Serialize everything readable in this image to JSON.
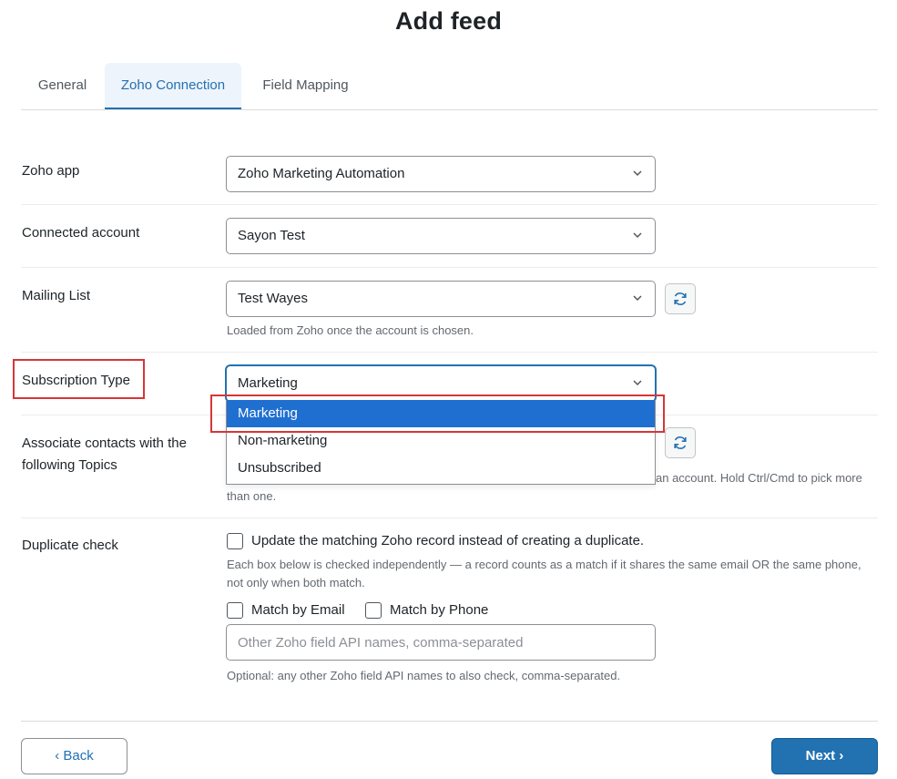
{
  "page": {
    "title": "Add feed"
  },
  "tabs": [
    {
      "label": "General",
      "active": false
    },
    {
      "label": "Zoho Connection",
      "active": true
    },
    {
      "label": "Field Mapping",
      "active": false
    }
  ],
  "form": {
    "zoho_app": {
      "label": "Zoho app",
      "value": "Zoho Marketing Automation"
    },
    "connected_account": {
      "label": "Connected account",
      "value": "Sayon Test"
    },
    "mailing_list": {
      "label": "Mailing List",
      "value": "Test Wayes",
      "help": "Loaded from Zoho once the account is chosen."
    },
    "subscription_type": {
      "label": "Subscription Type",
      "value": "Marketing",
      "options": [
        "Marketing",
        "Non-marketing",
        "Unsubscribed"
      ],
      "selected_option": "Marketing"
    },
    "topics": {
      "label_line1": "Associate contacts with the",
      "label_line2": "following Topics",
      "help_line1": "an account. Hold Ctrl/Cmd to pick more",
      "help_line2": "than one."
    },
    "duplicate_check": {
      "label": "Duplicate check",
      "update_label": "Update the matching Zoho record instead of creating a duplicate.",
      "help_line1": "Each box below is checked independently — a record counts as a match if it shares the same email OR the same phone,",
      "help_line2": "not only when both match.",
      "match_email_label": "Match by Email",
      "match_phone_label": "Match by Phone",
      "other_fields_placeholder": "Other Zoho field API names, comma-separated",
      "other_fields_help": "Optional: any other Zoho field API names to also check, comma-separated."
    }
  },
  "footer": {
    "back_label": "‹ Back",
    "next_label": "Next ›"
  },
  "colors": {
    "accent": "#2271b1",
    "highlight": "#d63638",
    "selected_option": "#1f6fd1"
  },
  "icons": {
    "select_arrow": "chevron-down-icon",
    "refresh": "refresh-icon"
  }
}
